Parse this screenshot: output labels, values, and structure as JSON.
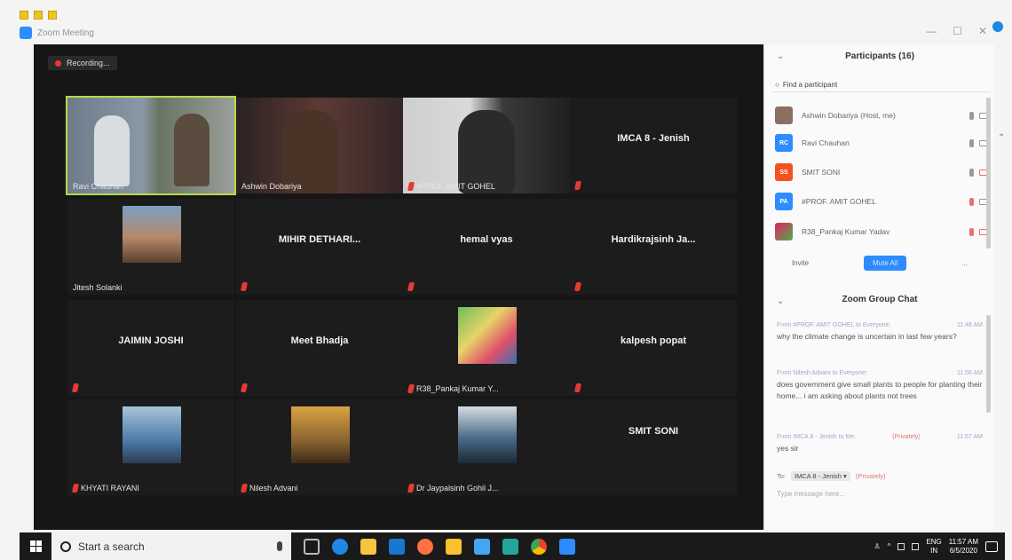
{
  "window": {
    "app_title": "Zoom Meeting",
    "min": "—",
    "max": "☐",
    "close": "✕"
  },
  "recording": {
    "label": "Recording..."
  },
  "tiles": [
    {
      "name": "Ravi Chauhan",
      "kind": "video",
      "active": true,
      "muted": false
    },
    {
      "name": "Ashwin Dobariya",
      "kind": "video",
      "active": false,
      "muted": false
    },
    {
      "name": "#PROF. AMIT GOHEL",
      "kind": "video",
      "active": false,
      "muted": true
    },
    {
      "name": "IMCA 8 - Jenish",
      "kind": "name",
      "muted": true
    },
    {
      "name": "Jitesh Solanki",
      "kind": "photo",
      "muted": false
    },
    {
      "name": "MIHIR DETHARI...",
      "kind": "name",
      "muted": true
    },
    {
      "name": "hemal vyas",
      "kind": "name",
      "muted": true
    },
    {
      "name": "Hardikrajsinh Ja...",
      "kind": "name",
      "muted": true
    },
    {
      "name": "JAIMIN JOSHI",
      "kind": "name",
      "muted": true
    },
    {
      "name": "Meet Bhadja",
      "kind": "name",
      "muted": true
    },
    {
      "name": "R38_Pankaj Kumar Y...",
      "kind": "photo",
      "muted": true
    },
    {
      "name": "kalpesh popat",
      "kind": "name",
      "muted": true
    },
    {
      "name": "KHYATI RAYANI",
      "kind": "photo",
      "muted": true
    },
    {
      "name": "Nilesh Advani",
      "kind": "photo",
      "muted": true
    },
    {
      "name": "Dr Jaypalsinh Gohil J...",
      "kind": "photo",
      "muted": true
    },
    {
      "name": "SMIT SONI",
      "kind": "name",
      "muted": false
    }
  ],
  "participants": {
    "title": "Participants (16)",
    "search_placeholder": "Find a participant",
    "list": [
      {
        "initials": "",
        "name": "Ashwin Dobariya (Host, me)",
        "color": "#8d6e63",
        "mic_off": false,
        "cam_off": false
      },
      {
        "initials": "RC",
        "name": "Ravi Chauhan",
        "color": "#2d8cff",
        "mic_off": false,
        "cam_off": false
      },
      {
        "initials": "SS",
        "name": "SMIT SONI",
        "color": "#f4511e",
        "mic_off": false,
        "cam_off": true
      },
      {
        "initials": "PA",
        "name": "#PROF. AMIT GOHEL",
        "color": "#2d8cff",
        "mic_off": true,
        "cam_off": false
      },
      {
        "initials": "",
        "name": "R38_Pankaj Kumar Yadav",
        "color": "#e91e63",
        "mic_off": true,
        "cam_off": true
      }
    ],
    "invite": "Invite",
    "mute_all": "Mute All",
    "more": "..."
  },
  "chat": {
    "title": "Zoom Group Chat",
    "messages": [
      {
        "from": "From #PROF. AMIT GOHEL to Everyone:",
        "time": "11:48 AM",
        "private": "",
        "text": "why the climate change is uncertain in last few years?"
      },
      {
        "from": "From Nilesh Advani to Everyone:",
        "time": "11:56 AM",
        "private": "",
        "text": "does government give small plants to people for planting their home... i am asking about plants not trees"
      },
      {
        "from": "From IMCA 8 - Jenish to Me:",
        "time": "11:57 AM",
        "private": "(Privately)",
        "text": "yes sir"
      }
    ],
    "to_label": "To:",
    "to_value": "IMCA 8 - Jenish ▾",
    "to_private": "(Privately)",
    "input_placeholder": "Type message here..."
  },
  "taskbar": {
    "search_text": "Start a search",
    "lang_top": "ENG",
    "lang_bottom": "IN",
    "time": "11:57 AM",
    "date": "6/5/2020"
  },
  "colors": {
    "accent": "#2d8cff",
    "active_speaker": "#b8d84a",
    "muted": "#e53935"
  }
}
